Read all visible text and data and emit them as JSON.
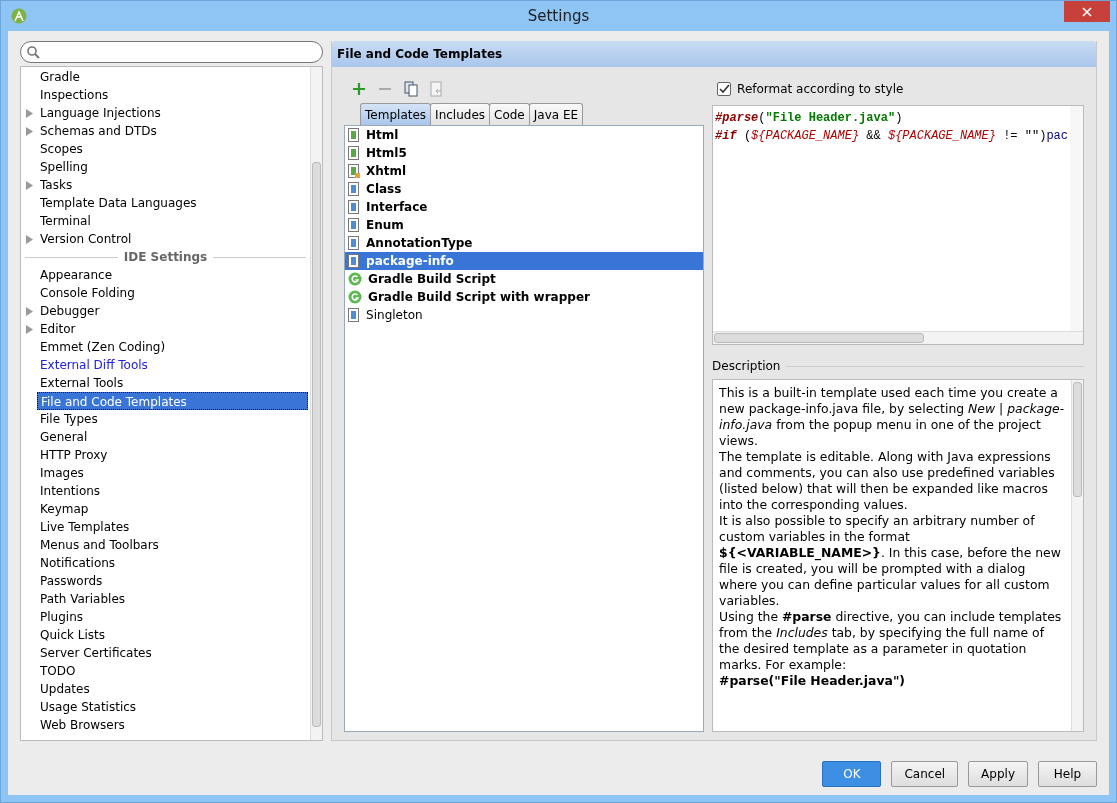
{
  "window": {
    "title": "Settings"
  },
  "sidebar": {
    "items": [
      {
        "kind": "item",
        "label": "Gradle",
        "expandable": false,
        "selected": false,
        "changed": false
      },
      {
        "kind": "item",
        "label": "Inspections",
        "expandable": false,
        "selected": false,
        "changed": false
      },
      {
        "kind": "item",
        "label": "Language Injections",
        "expandable": true,
        "selected": false,
        "changed": false
      },
      {
        "kind": "item",
        "label": "Schemas and DTDs",
        "expandable": true,
        "selected": false,
        "changed": false
      },
      {
        "kind": "item",
        "label": "Scopes",
        "expandable": false,
        "selected": false,
        "changed": false
      },
      {
        "kind": "item",
        "label": "Spelling",
        "expandable": false,
        "selected": false,
        "changed": false
      },
      {
        "kind": "item",
        "label": "Tasks",
        "expandable": true,
        "selected": false,
        "changed": false
      },
      {
        "kind": "item",
        "label": "Template Data Languages",
        "expandable": false,
        "selected": false,
        "changed": false
      },
      {
        "kind": "item",
        "label": "Terminal",
        "expandable": false,
        "selected": false,
        "changed": false
      },
      {
        "kind": "item",
        "label": "Version Control",
        "expandable": true,
        "selected": false,
        "changed": false
      },
      {
        "kind": "group",
        "label": "IDE Settings"
      },
      {
        "kind": "item",
        "label": "Appearance",
        "expandable": false,
        "selected": false,
        "changed": false
      },
      {
        "kind": "item",
        "label": "Console Folding",
        "expandable": false,
        "selected": false,
        "changed": false
      },
      {
        "kind": "item",
        "label": "Debugger",
        "expandable": true,
        "selected": false,
        "changed": false
      },
      {
        "kind": "item",
        "label": "Editor",
        "expandable": true,
        "selected": false,
        "changed": false
      },
      {
        "kind": "item",
        "label": "Emmet (Zen Coding)",
        "expandable": false,
        "selected": false,
        "changed": false
      },
      {
        "kind": "item",
        "label": "External Diff Tools",
        "expandable": false,
        "selected": false,
        "changed": true
      },
      {
        "kind": "item",
        "label": "External Tools",
        "expandable": false,
        "selected": false,
        "changed": false
      },
      {
        "kind": "item",
        "label": "File and Code Templates",
        "expandable": false,
        "selected": true,
        "changed": false
      },
      {
        "kind": "item",
        "label": "File Types",
        "expandable": false,
        "selected": false,
        "changed": false
      },
      {
        "kind": "item",
        "label": "General",
        "expandable": false,
        "selected": false,
        "changed": false
      },
      {
        "kind": "item",
        "label": "HTTP Proxy",
        "expandable": false,
        "selected": false,
        "changed": false
      },
      {
        "kind": "item",
        "label": "Images",
        "expandable": false,
        "selected": false,
        "changed": false
      },
      {
        "kind": "item",
        "label": "Intentions",
        "expandable": false,
        "selected": false,
        "changed": false
      },
      {
        "kind": "item",
        "label": "Keymap",
        "expandable": false,
        "selected": false,
        "changed": false
      },
      {
        "kind": "item",
        "label": "Live Templates",
        "expandable": false,
        "selected": false,
        "changed": false
      },
      {
        "kind": "item",
        "label": "Menus and Toolbars",
        "expandable": false,
        "selected": false,
        "changed": false
      },
      {
        "kind": "item",
        "label": "Notifications",
        "expandable": false,
        "selected": false,
        "changed": false
      },
      {
        "kind": "item",
        "label": "Passwords",
        "expandable": false,
        "selected": false,
        "changed": false
      },
      {
        "kind": "item",
        "label": "Path Variables",
        "expandable": false,
        "selected": false,
        "changed": false
      },
      {
        "kind": "item",
        "label": "Plugins",
        "expandable": false,
        "selected": false,
        "changed": false
      },
      {
        "kind": "item",
        "label": "Quick Lists",
        "expandable": false,
        "selected": false,
        "changed": false
      },
      {
        "kind": "item",
        "label": "Server Certificates",
        "expandable": false,
        "selected": false,
        "changed": false
      },
      {
        "kind": "item",
        "label": "TODO",
        "expandable": false,
        "selected": false,
        "changed": false
      },
      {
        "kind": "item",
        "label": "Updates",
        "expandable": false,
        "selected": false,
        "changed": false
      },
      {
        "kind": "item",
        "label": "Usage Statistics",
        "expandable": false,
        "selected": false,
        "changed": false
      },
      {
        "kind": "item",
        "label": "Web Browsers",
        "expandable": false,
        "selected": false,
        "changed": false
      }
    ]
  },
  "panel": {
    "title": "File and Code Templates",
    "toolbar": [
      {
        "kind": "add",
        "disabled": false
      },
      {
        "kind": "remove",
        "disabled": true
      },
      {
        "kind": "copy",
        "disabled": false
      },
      {
        "kind": "reset",
        "disabled": true
      }
    ],
    "tabs": [
      {
        "label": "Templates",
        "selected": true
      },
      {
        "label": "Includes",
        "selected": false
      },
      {
        "label": "Code",
        "selected": false
      },
      {
        "label": "Java EE",
        "selected": false
      }
    ],
    "templates": [
      {
        "kind": "html",
        "label": "Html",
        "bold": true,
        "selected": false
      },
      {
        "kind": "html",
        "label": "Html5",
        "bold": true,
        "selected": false
      },
      {
        "kind": "xhtml",
        "label": "Xhtml",
        "bold": true,
        "selected": false
      },
      {
        "kind": "java",
        "label": "Class",
        "bold": true,
        "selected": false
      },
      {
        "kind": "java",
        "label": "Interface",
        "bold": true,
        "selected": false
      },
      {
        "kind": "java",
        "label": "Enum",
        "bold": true,
        "selected": false
      },
      {
        "kind": "java",
        "label": "AnnotationType",
        "bold": true,
        "selected": false
      },
      {
        "kind": "java",
        "label": "package-info",
        "bold": true,
        "selected": true
      },
      {
        "kind": "gradle",
        "label": "Gradle Build Script",
        "bold": true,
        "selected": false
      },
      {
        "kind": "gradle",
        "label": "Gradle Build Script with wrapper",
        "bold": true,
        "selected": false
      },
      {
        "kind": "java",
        "label": "Singleton",
        "bold": false,
        "selected": false
      }
    ],
    "reformat": {
      "label": "Reformat according to style",
      "checked": true
    },
    "code": [
      [
        {
          "kind": "directive",
          "text": "#parse"
        },
        {
          "kind": "plain",
          "text": "("
        },
        {
          "kind": "string",
          "text": "\"File Header.java\""
        },
        {
          "kind": "plain",
          "text": ")"
        }
      ],
      [
        {
          "kind": "directive",
          "text": "#if"
        },
        {
          "kind": "plain",
          "text": " ("
        },
        {
          "kind": "variable",
          "text": "${PACKAGE_NAME}"
        },
        {
          "kind": "plain",
          "text": " && "
        },
        {
          "kind": "variable",
          "text": "${PACKAGE_NAME}"
        },
        {
          "kind": "plain",
          "text": " != \"\")"
        },
        {
          "kind": "java",
          "text": "pac"
        }
      ]
    ],
    "description_label": "Description",
    "description": [
      "This is a built-in template used each time you create a new package-info.java file, by selecting *New* | *package-info.java* from the popup menu in one of the project views.",
      "The template is editable. Along with Java expressions and comments, you can also use predefined variables (listed below) that will then be expanded like macros into the corresponding values.",
      "It is also possible to specify an arbitrary number of custom variables in the format **${<VARIABLE_NAME>}**. In this case, before the new file is created, you will be prompted with a dialog where you can define particular values for all custom variables.",
      "Using the **#parse** directive, you can include templates from the *Includes* tab, by specifying the full name of the desired template as a parameter in quotation marks. For example:",
      "**#parse(\"File Header.java\")**"
    ]
  },
  "buttons": [
    {
      "label": "OK",
      "default": true
    },
    {
      "label": "Cancel",
      "default": false
    },
    {
      "label": "Apply",
      "default": false
    },
    {
      "label": "Help",
      "default": false
    }
  ]
}
